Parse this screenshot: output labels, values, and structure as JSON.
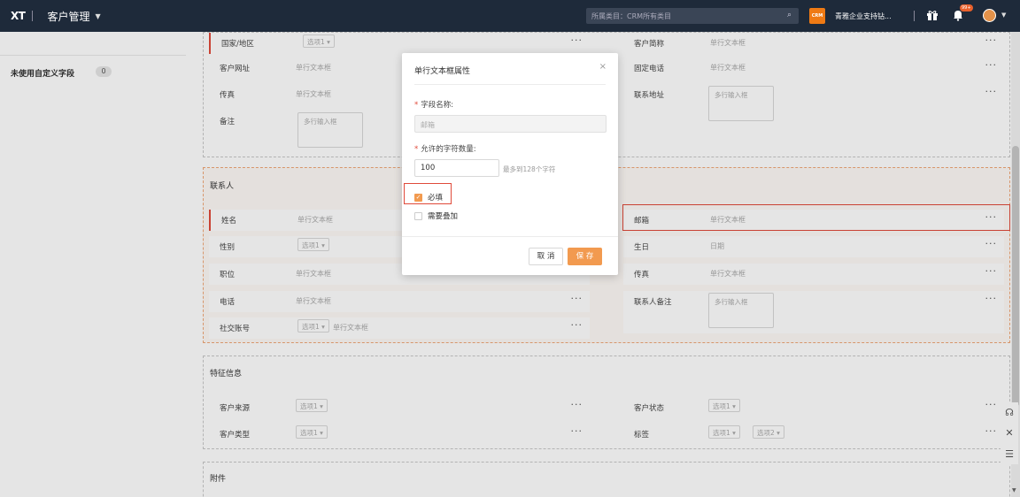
{
  "topbar": {
    "logo": "XT",
    "app_name": "客户管理",
    "search_placeholder": "所属类目：CRM所有类目",
    "company_logo": "CRM",
    "company_name": "青雅企业支持钻...",
    "bell_badge": "99+"
  },
  "sidebar": {
    "label": "未使用自定义字段",
    "count": "0"
  },
  "section1": {
    "left_fields": [
      {
        "label": "国家/地区",
        "select": "选项1"
      },
      {
        "label": "客户网址",
        "value": "单行文本框"
      },
      {
        "label": "传真",
        "value": "单行文本框"
      },
      {
        "label": "备注",
        "textarea": "多行输入框"
      }
    ],
    "right_fields": [
      {
        "label": "客户简称",
        "value": "单行文本框"
      },
      {
        "label": "固定电话",
        "value": "单行文本框"
      },
      {
        "label": "联系地址",
        "textarea": "多行输入框"
      }
    ]
  },
  "contacts": {
    "title": "联系人",
    "left_fields": [
      {
        "label": "姓名",
        "value": "单行文本框"
      },
      {
        "label": "性别",
        "select": "选项1"
      },
      {
        "label": "职位",
        "value": "单行文本框"
      },
      {
        "label": "电话",
        "value": "单行文本框"
      },
      {
        "label": "社交账号",
        "select": "选项1",
        "value": "单行文本框"
      }
    ],
    "right_fields": [
      {
        "label": "邮箱",
        "value": "单行文本框"
      },
      {
        "label": "生日",
        "value": "日期"
      },
      {
        "label": "传真",
        "value": "单行文本框"
      },
      {
        "label": "联系人备注",
        "textarea": "多行输入框"
      }
    ]
  },
  "features": {
    "title": "特征信息",
    "left_fields": [
      {
        "label": "客户来源",
        "select": "选项1"
      },
      {
        "label": "客户类型",
        "select": "选项1"
      }
    ],
    "right_fields": [
      {
        "label": "客户状态",
        "select": "选项1"
      },
      {
        "label": "标签",
        "select": "选项1",
        "select2": "选项2"
      }
    ]
  },
  "attachments": {
    "title": "附件"
  },
  "modal": {
    "title": "单行文本框属性",
    "close": "×",
    "field_name_label": "字段名称:",
    "field_name_value": "邮箱",
    "char_count_label": "允许的字符数量:",
    "char_count_value": "100",
    "char_count_hint": "最多到128个字符",
    "required_label": "必填",
    "required_checked": true,
    "stack_label": "需要叠加",
    "stack_checked": false,
    "cancel_label": "取 消",
    "save_label": "保 存"
  },
  "colors": {
    "topbar_bg": "#1e2a3a",
    "accent": "#f29a4f",
    "highlight_red": "#e04a3a"
  }
}
